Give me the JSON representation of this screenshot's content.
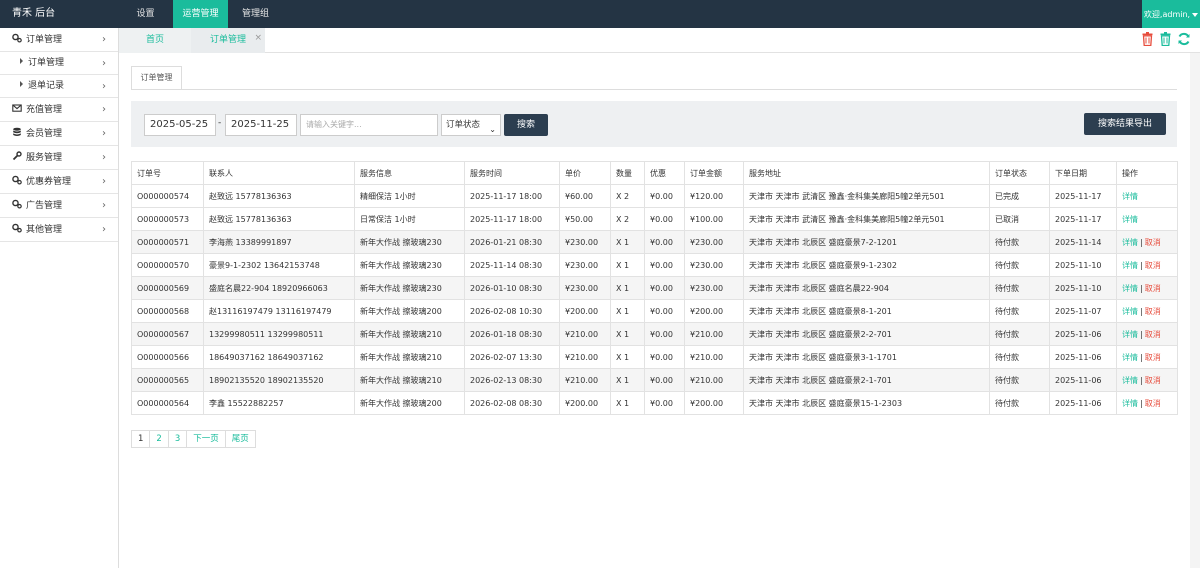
{
  "topbar": {
    "brand": "青禾 后台",
    "nav": [
      {
        "label": "设置"
      },
      {
        "label": "运营管理"
      },
      {
        "label": "管理组"
      }
    ],
    "user": "欢迎,admin,"
  },
  "sidebar": {
    "items": [
      {
        "label": "订单管理",
        "icon": "gears-icon"
      },
      {
        "label": "订单管理",
        "icon": "caret-right-icon"
      },
      {
        "label": "退单记录",
        "icon": "caret-right-icon"
      },
      {
        "label": "充值管理",
        "icon": "envelope-icon"
      },
      {
        "label": "会员管理",
        "icon": "database-icon"
      },
      {
        "label": "服务管理",
        "icon": "wrench-icon"
      },
      {
        "label": "优惠券管理",
        "icon": "gears-icon"
      },
      {
        "label": "广告管理",
        "icon": "gears-icon"
      },
      {
        "label": "其他管理",
        "icon": "gears-icon"
      }
    ]
  },
  "tabs": {
    "home": "首页",
    "order": "订单管理",
    "close": "×"
  },
  "colors": {
    "accent": "#1abc9c",
    "topbar": "#243444",
    "button": "#2c3e50",
    "cancel": "#e74c3c"
  },
  "panel": {
    "tab": "订单管理"
  },
  "search": {
    "start_date": "2025-05-25",
    "dash": "-",
    "end_date": "2025-11-25",
    "keyword_placeholder": "请输入关键字...",
    "status_select": "订单状态",
    "search_btn": "搜索",
    "export_btn": "搜索结果导出"
  },
  "table": {
    "headers": [
      "订单号",
      "联系人",
      "服务信息",
      "服务时间",
      "单价",
      "数量",
      "优惠",
      "订单金额",
      "服务地址",
      "订单状态",
      "下单日期",
      "操作"
    ],
    "detail": "详情",
    "cancel": "取消",
    "sep": "|",
    "rows": [
      {
        "id": "O000000574",
        "contact": "赵致远 15778136363",
        "service": "精细保洁 1小时",
        "time": "2025-11-17 18:00",
        "price": "¥60.00",
        "qty": "X 2",
        "discount": "¥0.00",
        "amount": "¥120.00",
        "address": "天津市 天津市 武清区 豫鑫·金科集美廊阳5幢2单元501",
        "status": "已完成",
        "date": "2025-11-17",
        "cancelable": false
      },
      {
        "id": "O000000573",
        "contact": "赵致远 15778136363",
        "service": "日常保洁 1小时",
        "time": "2025-11-17 18:00",
        "price": "¥50.00",
        "qty": "X 2",
        "discount": "¥0.00",
        "amount": "¥100.00",
        "address": "天津市 天津市 武清区 豫鑫·金科集美廊阳5幢2单元501",
        "status": "已取消",
        "date": "2025-11-17",
        "cancelable": false
      },
      {
        "id": "O000000571",
        "contact": "李海燕 13389991897",
        "service": "新年大作战 擦玻璃230",
        "time": "2026-01-21 08:30",
        "price": "¥230.00",
        "qty": "X 1",
        "discount": "¥0.00",
        "amount": "¥230.00",
        "address": "天津市 天津市 北辰区 盛庭豪景7-2-1201",
        "status": "待付款",
        "date": "2025-11-14",
        "cancelable": true
      },
      {
        "id": "O000000570",
        "contact": "豪景9-1-2302 13642153748",
        "service": "新年大作战 擦玻璃230",
        "time": "2025-11-14 08:30",
        "price": "¥230.00",
        "qty": "X 1",
        "discount": "¥0.00",
        "amount": "¥230.00",
        "address": "天津市 天津市 北辰区 盛庭豪景9-1-2302",
        "status": "待付款",
        "date": "2025-11-10",
        "cancelable": true
      },
      {
        "id": "O000000569",
        "contact": "盛庭名晨22-904 18920966063",
        "service": "新年大作战 擦玻璃230",
        "time": "2026-01-10 08:30",
        "price": "¥230.00",
        "qty": "X 1",
        "discount": "¥0.00",
        "amount": "¥230.00",
        "address": "天津市 天津市 北辰区 盛庭名晨22-904",
        "status": "待付款",
        "date": "2025-11-10",
        "cancelable": true
      },
      {
        "id": "O000000568",
        "contact": "赵13116197479 13116197479",
        "service": "新年大作战 擦玻璃200",
        "time": "2026-02-08 10:30",
        "price": "¥200.00",
        "qty": "X 1",
        "discount": "¥0.00",
        "amount": "¥200.00",
        "address": "天津市 天津市 北辰区 盛庭豪景8-1-201",
        "status": "待付款",
        "date": "2025-11-07",
        "cancelable": true
      },
      {
        "id": "O000000567",
        "contact": "13299980511 13299980511",
        "service": "新年大作战 擦玻璃210",
        "time": "2026-01-18 08:30",
        "price": "¥210.00",
        "qty": "X 1",
        "discount": "¥0.00",
        "amount": "¥210.00",
        "address": "天津市 天津市 北辰区 盛庭豪景2-2-701",
        "status": "待付款",
        "date": "2025-11-06",
        "cancelable": true
      },
      {
        "id": "O000000566",
        "contact": "18649037162 18649037162",
        "service": "新年大作战 擦玻璃210",
        "time": "2026-02-07 13:30",
        "price": "¥210.00",
        "qty": "X 1",
        "discount": "¥0.00",
        "amount": "¥210.00",
        "address": "天津市 天津市 北辰区 盛庭豪景3-1-1701",
        "status": "待付款",
        "date": "2025-11-06",
        "cancelable": true
      },
      {
        "id": "O000000565",
        "contact": "18902135520 18902135520",
        "service": "新年大作战 擦玻璃210",
        "time": "2026-02-13 08:30",
        "price": "¥210.00",
        "qty": "X 1",
        "discount": "¥0.00",
        "amount": "¥210.00",
        "address": "天津市 天津市 北辰区 盛庭豪景2-1-701",
        "status": "待付款",
        "date": "2025-11-06",
        "cancelable": true
      },
      {
        "id": "O000000564",
        "contact": "李鑫 15522882257",
        "service": "新年大作战 擦玻璃200",
        "time": "2026-02-08 08:30",
        "price": "¥200.00",
        "qty": "X 1",
        "discount": "¥0.00",
        "amount": "¥200.00",
        "address": "天津市 天津市 北辰区 盛庭豪景15-1-2303",
        "status": "待付款",
        "date": "2025-11-06",
        "cancelable": true
      }
    ]
  },
  "pager": {
    "pages": [
      "1",
      "2",
      "3"
    ],
    "next": "下一页",
    "last": "尾页"
  }
}
